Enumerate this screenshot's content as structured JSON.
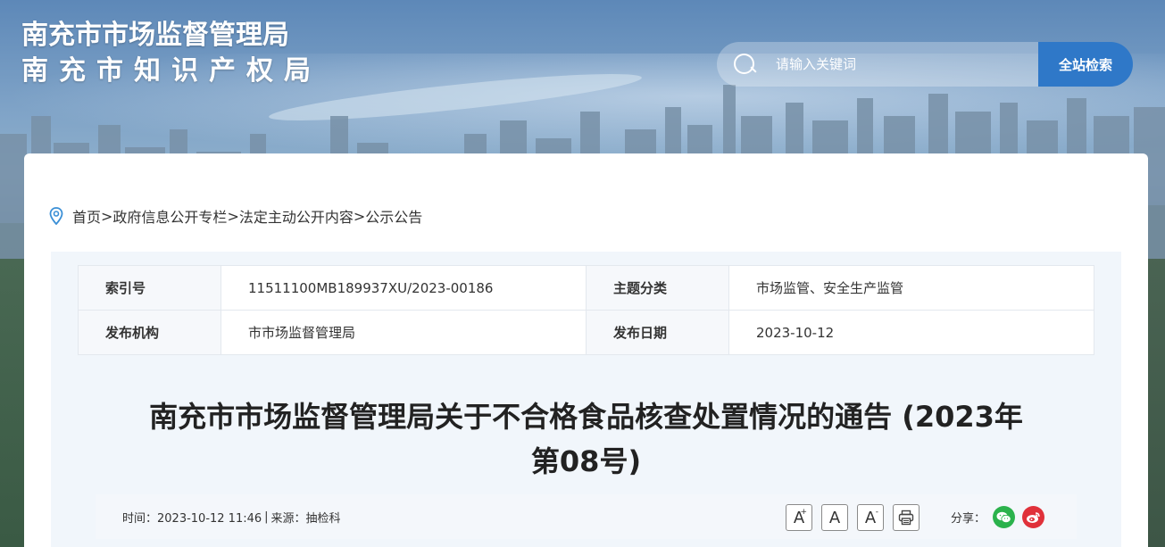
{
  "header": {
    "logo_line1": "南充市市场监督管理局",
    "logo_line2": "南充市知识产权局",
    "search_placeholder": "请输入关键词",
    "search_button": "全站检索"
  },
  "breadcrumb": {
    "items": [
      "首页",
      "政府信息公开专栏",
      "法定主动公开内容",
      "公示公告"
    ],
    "separator": ">"
  },
  "info": {
    "index_label": "索引号",
    "index_value": "11511100MB189937XU/2023-00186",
    "topic_label": "主题分类",
    "topic_value": "市场监管、安全生产监管",
    "publisher_label": "发布机构",
    "publisher_value": "市市场监督管理局",
    "date_label": "发布日期",
    "date_value": "2023-10-12"
  },
  "article": {
    "title_line1": "南充市市场监督管理局关于不合格食品核查处置情况的通告 (2023年",
    "title_line2": "第08号)"
  },
  "meta": {
    "time": "时间：2023-10-12 11:46",
    "divider": "|",
    "source": "来源：抽检科",
    "font_large": "A",
    "font_large_sup": "+",
    "font_normal": "A",
    "font_small": "A",
    "font_small_sup": "-",
    "share_label": "分享："
  },
  "icons": {
    "pin": "location-pin-icon",
    "search": "search-icon",
    "print": "printer-icon",
    "wechat": "wechat-icon",
    "weibo": "weibo-icon"
  },
  "colors": {
    "search_button": "#2f78c8",
    "wechat": "#2bb24c",
    "weibo": "#e0313a",
    "pin": "#3a8fd6"
  }
}
